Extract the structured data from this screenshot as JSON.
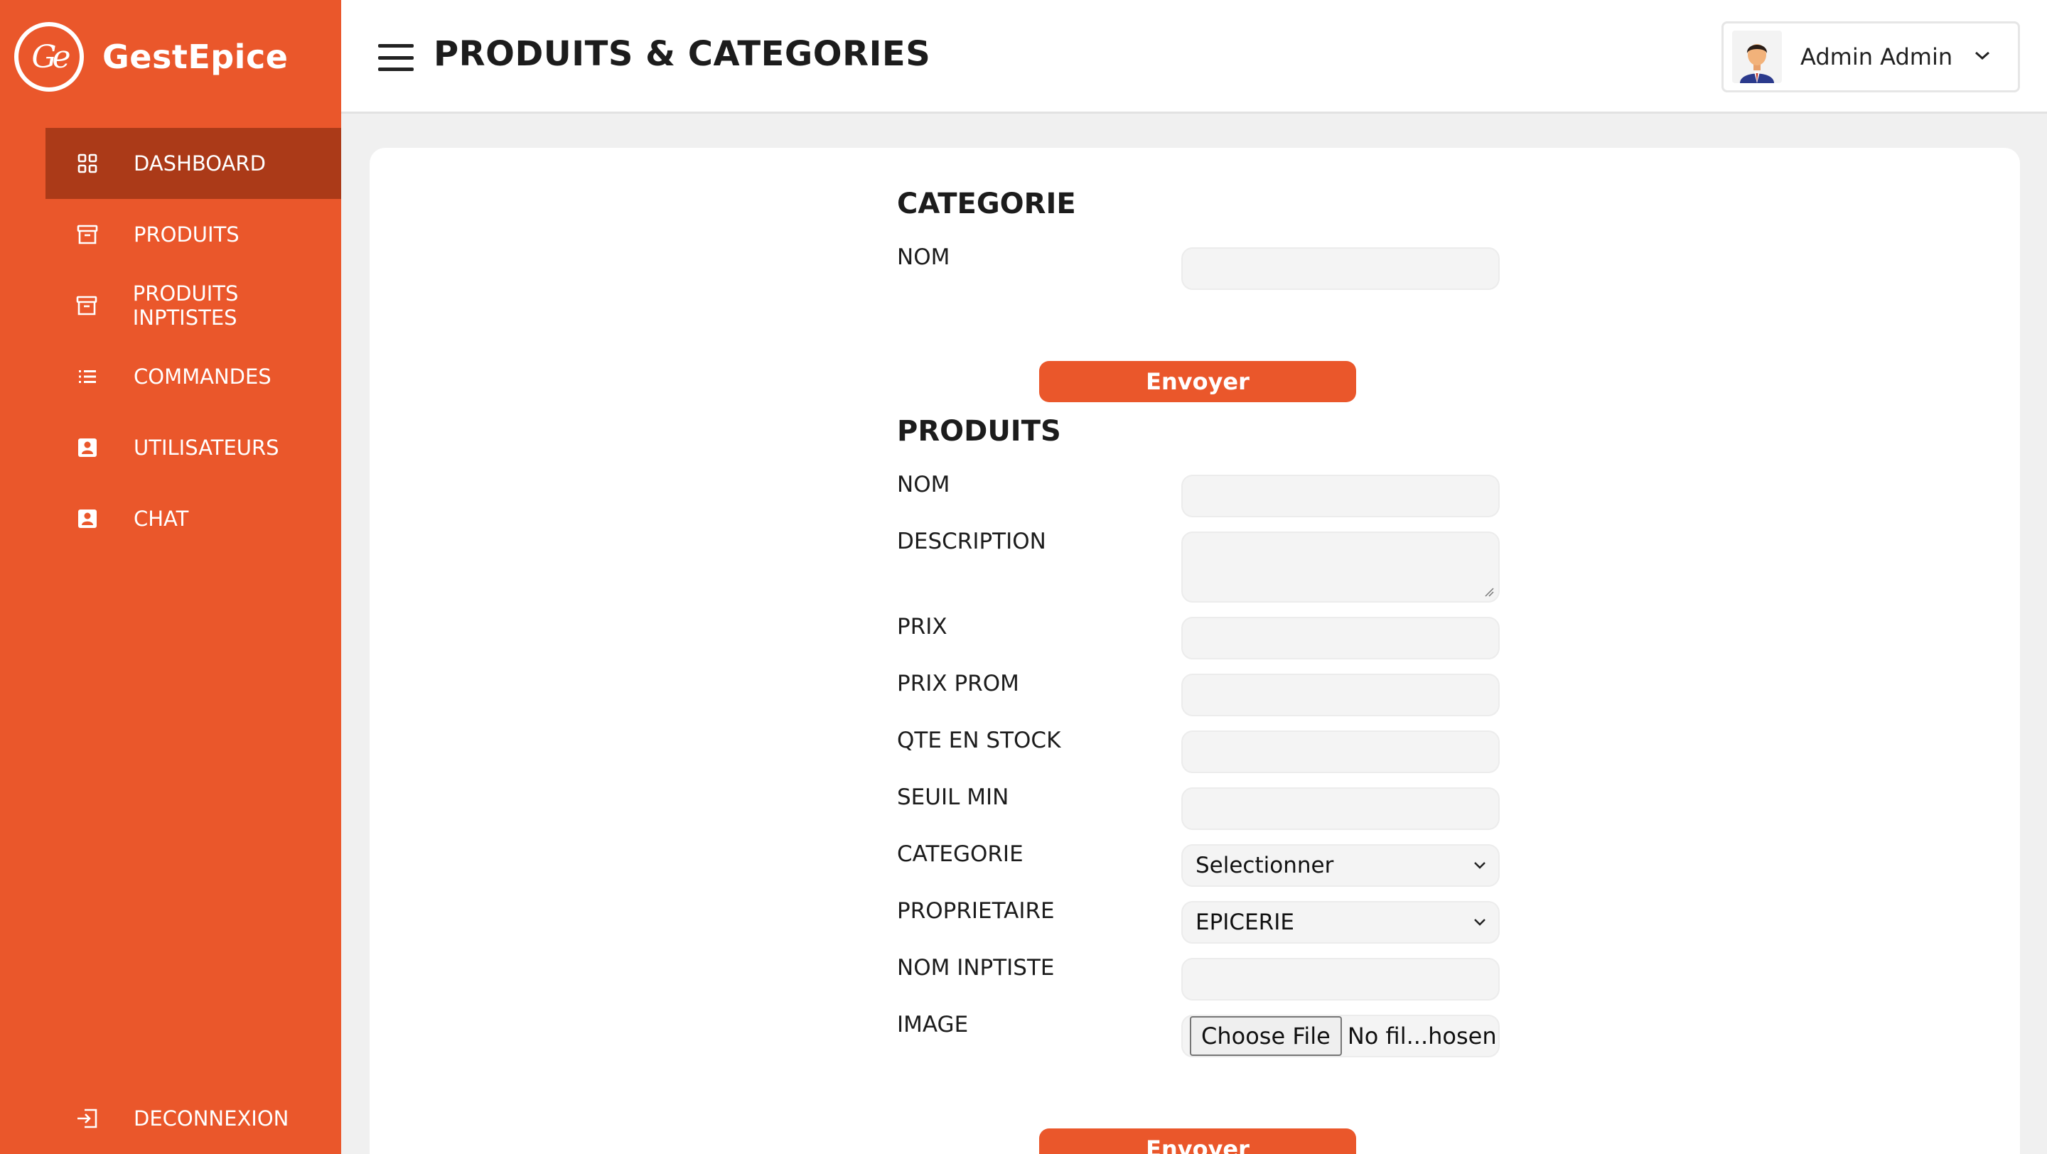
{
  "app": {
    "name": "GestEpice",
    "logo_text": "Ge"
  },
  "colors": {
    "brand": "#ea572b",
    "brand_dark": "#ab3a18"
  },
  "sidebar": {
    "items": [
      {
        "label": "DASHBOARD",
        "icon": "grid-icon",
        "active": true
      },
      {
        "label": "PRODUITS",
        "icon": "archive-icon",
        "active": false
      },
      {
        "label": "PRODUITS INPTISTES",
        "icon": "archive-icon",
        "active": false
      },
      {
        "label": "COMMANDES",
        "icon": "list-icon",
        "active": false
      },
      {
        "label": "UTILISATEURS",
        "icon": "user-badge-icon",
        "active": false
      },
      {
        "label": "CHAT",
        "icon": "user-badge-icon",
        "active": false
      }
    ],
    "logout_label": "DECONNEXION"
  },
  "header": {
    "title": "PRODUITS & CATEGORIES",
    "user_name": "Admin Admin"
  },
  "categorie_form": {
    "title": "CATEGORIE",
    "nom_label": "NOM",
    "nom_value": "",
    "submit_label": "Envoyer"
  },
  "produits_form": {
    "title": "PRODUITS",
    "nom_label": "NOM",
    "description_label": "DESCRIPTION",
    "prix_label": "PRIX",
    "prix_prom_label": "PRIX PROM",
    "qte_label": "QTE EN STOCK",
    "seuil_label": "SEUIL MIN",
    "categorie_label": "CATEGORIE",
    "categorie_value": "Selectionner",
    "proprietaire_label": "PROPRIETAIRE",
    "proprietaire_value": "EPICERIE",
    "nom_inptiste_label": "NOM INPTISTE",
    "image_label": "IMAGE",
    "file_button_label": "Choose File",
    "file_status": "No fil...hosen",
    "submit_label": "Envoyer"
  }
}
